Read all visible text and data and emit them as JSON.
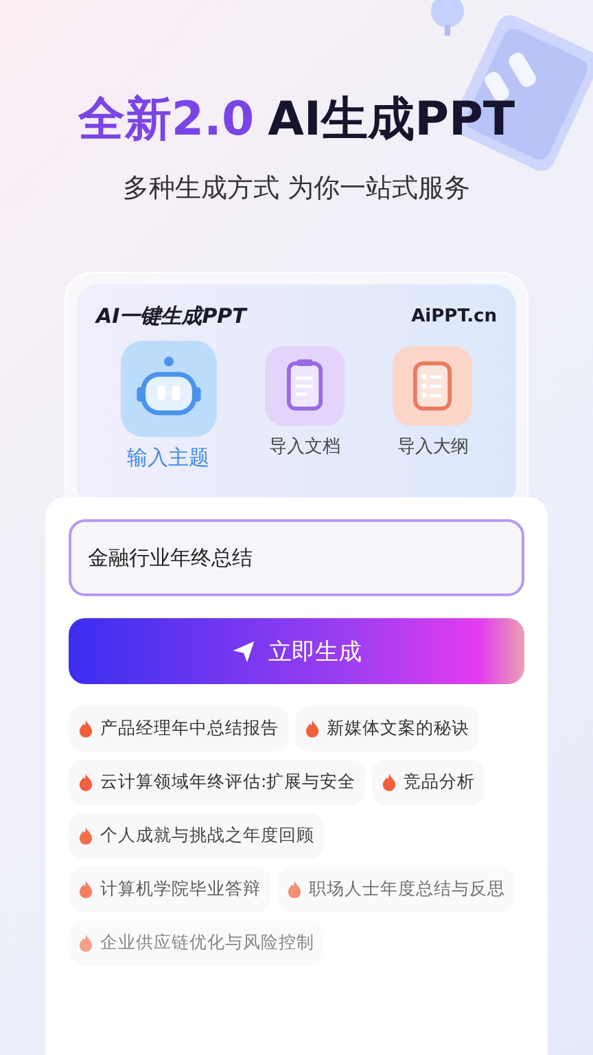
{
  "hero": {
    "title_accent": "全新2.0",
    "title_rest": "AI生成PPT",
    "subtitle": "多种生成方式 为你一站式服务"
  },
  "card": {
    "heading": "AI一键生成PPT",
    "logo": "AiPPT.cn",
    "tabs": [
      {
        "label": "输入主题",
        "kind": "robot",
        "selected": true
      },
      {
        "label": "导入文档",
        "kind": "document",
        "selected": false
      },
      {
        "label": "导入大纲",
        "kind": "outline",
        "selected": false
      }
    ]
  },
  "topic_input": {
    "value": "金融行业年终总结"
  },
  "generate_button": {
    "label": "立即生成"
  },
  "suggestions": [
    "产品经理年中总结报告",
    "新媒体文案的秘诀",
    "云计算领域年终评估:扩展与安全",
    "竞品分析",
    "个人成就与挑战之年度回顾",
    "计算机学院毕业答辩",
    "职场人士年度总结与反思",
    "企业供应链优化与风险控制"
  ]
}
